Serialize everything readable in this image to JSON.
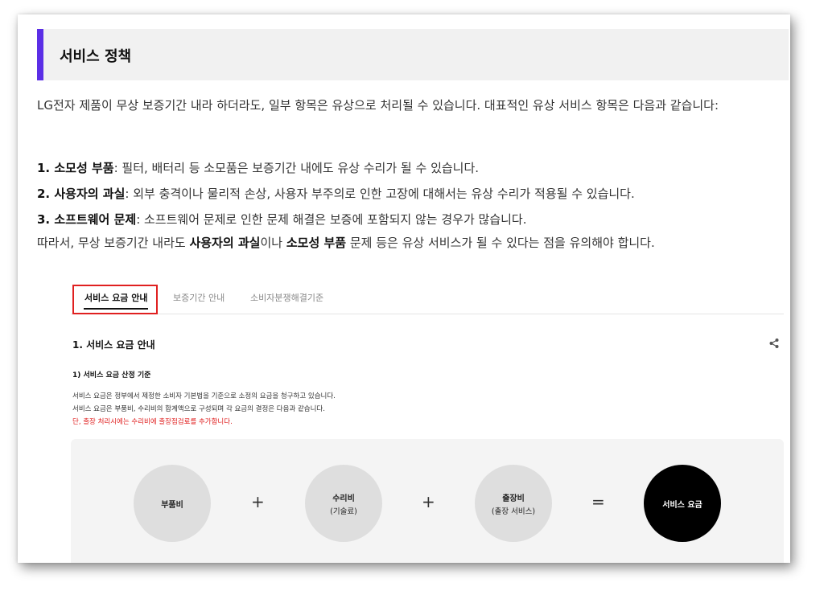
{
  "header": {
    "title": "서비스 정책"
  },
  "intro": "LG전자 제품이 무상 보증기간 내라 하더라도, 일부 항목은 유상으로 처리될 수 있습니다. 대표적인 유상 서비스 항목은 다음과 같습니다:",
  "items": [
    {
      "term": "1. 소모성 부품",
      "desc": ": 필터, 배터리 등 소모품은 보증기간 내에도 유상 수리가 될 수 있습니다."
    },
    {
      "term": "2. 사용자의 과실",
      "desc": ": 외부 충격이나 물리적 손상, 사용자 부주의로 인한 고장에 대해서는 유상 수리가 적용될 수 있습니다."
    },
    {
      "term": "3. 소프트웨어 문제",
      "desc": ": 소프트웨어 문제로 인한 문제 해결은 보증에 포함되지 않는 경우가 많습니다."
    }
  ],
  "conclusion": {
    "pre": "따라서, 무상 보증기간 내라도 ",
    "b1": "사용자의 과실",
    "mid": "이나 ",
    "b2": "소모성 부품",
    "post": " 문제 등은 유상 서비스가 될 수 있다는 점을 유의해야 합니다."
  },
  "screenshot": {
    "tabs": [
      "서비스 요금 안내",
      "보증기간 안내",
      "소비자분쟁해결기준"
    ],
    "section_title": "1. 서비스 요금 안내",
    "share_icon": "share-icon",
    "sub_title": "1) 서비스 요금 산정 기준",
    "lines": [
      "서비스 요금은 정부에서 제정한 소비자 기본법을 기준으로 소정의 요금을 청구하고 있습니다.",
      "서비스 요금은 부품비, 수리비의 합계액으로 구성되며 각 요금의 결정은 다음과 같습니다."
    ],
    "red_line": "단, 출장 처리시에는 수리비에 출장점검료를 추가합니다.",
    "formula": {
      "c1": "부품비",
      "op1": "+",
      "c2": "수리비",
      "c2_sub": "(기술료)",
      "op2": "+",
      "c3": "출장비",
      "c3_sub": "(출장 서비스)",
      "op3": "=",
      "result": "서비스 요금"
    }
  },
  "colors": {
    "accent": "#5b2ee6",
    "highlight_box": "#e02020",
    "result_circle": "#000000"
  }
}
